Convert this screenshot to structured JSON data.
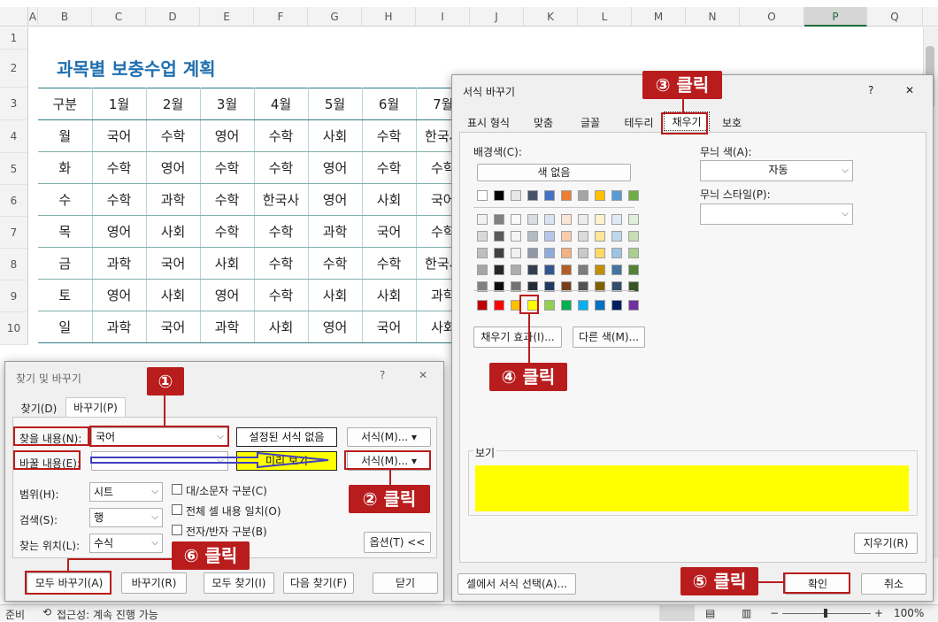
{
  "sheet": {
    "columns": [
      "A",
      "B",
      "C",
      "D",
      "E",
      "F",
      "G",
      "H",
      "I",
      "J",
      "K",
      "L",
      "M",
      "N",
      "O",
      "P",
      "Q"
    ],
    "rows": [
      "1",
      "2",
      "3",
      "4",
      "5",
      "6",
      "7",
      "8",
      "9",
      "10"
    ],
    "title": "과목별 보충수업 계획",
    "table": [
      [
        "구분",
        "1월",
        "2월",
        "3월",
        "4월",
        "5월",
        "6월",
        "7월"
      ],
      [
        "월",
        "국어",
        "수학",
        "영어",
        "수학",
        "사회",
        "수학",
        "한국사"
      ],
      [
        "화",
        "수학",
        "영어",
        "수학",
        "수학",
        "영어",
        "수학",
        "수학"
      ],
      [
        "수",
        "수학",
        "과학",
        "수학",
        "한국사",
        "영어",
        "사회",
        "국어"
      ],
      [
        "목",
        "영어",
        "사회",
        "수학",
        "수학",
        "과학",
        "국어",
        "수학"
      ],
      [
        "금",
        "과학",
        "국어",
        "사회",
        "수학",
        "수학",
        "수학",
        "한국사"
      ],
      [
        "토",
        "영어",
        "사회",
        "영어",
        "수학",
        "사회",
        "사회",
        "과학"
      ],
      [
        "일",
        "과학",
        "국어",
        "과학",
        "사회",
        "영어",
        "국어",
        "사회"
      ]
    ]
  },
  "status": {
    "ready": "준비",
    "accessibility": "접근성: 계속 진행 가능",
    "zoom": "100%"
  },
  "find_dialog": {
    "title": "찾기 및 바꾸기",
    "help": "?",
    "close": "✕",
    "tabs": [
      "찾기(D)",
      "바꾸기(P)"
    ],
    "find_label": "찾을 내용(N):",
    "find_value": "국어",
    "replace_label": "바꿀 내용(E):",
    "replace_value": "",
    "no_format": "설정된 서식 없음",
    "format_btn": "서식(M)...",
    "preview": "미리 보기",
    "scope_label": "범위(H):",
    "scope_value": "시트",
    "search_label": "검색(S):",
    "search_value": "행",
    "lookin_label": "찾는 위치(L):",
    "lookin_value": "수식",
    "opt_case": "대/소문자 구분(C)",
    "opt_whole": "전체 셀 내용 일치(O)",
    "opt_width": "전자/반자 구분(B)",
    "options_btn": "옵션(T) <<",
    "replace_all": "모두 바꾸기(A)",
    "replace": "바꾸기(R)",
    "find_all": "모두 찾기(I)",
    "find_next": "다음 찾기(F)",
    "close_btn": "닫기"
  },
  "format_dialog": {
    "title": "서식 바꾸기",
    "help": "?",
    "close": "✕",
    "tabs": [
      "표시 형식",
      "맞춤",
      "글꼴",
      "테두리",
      "채우기",
      "보호"
    ],
    "bg_label": "배경색(C):",
    "no_color": "색 없음",
    "fill_effects": "채우기 효과(I)...",
    "more_colors": "다른 색(M)...",
    "pattern_color_label": "무늬 색(A):",
    "pattern_color_value": "자동",
    "pattern_style_label": "무늬 스타일(P):",
    "sample_label": "보기",
    "sample_color": "#ffff00",
    "clear": "지우기(R)",
    "choose_from_cell": "셀에서 서식 선택(A)...",
    "ok": "확인",
    "cancel": "취소",
    "theme_colors": [
      "#ffffff",
      "#000000",
      "#e7e6e6",
      "#44546a",
      "#4472c4",
      "#ed7d31",
      "#a5a5a5",
      "#ffc000",
      "#5b9bd5",
      "#70ad47"
    ],
    "standard_colors": [
      "#c00000",
      "#ff0000",
      "#ffc000",
      "#ffff00",
      "#92d050",
      "#00b050",
      "#00b0f0",
      "#0070c0",
      "#002060",
      "#7030a0"
    ]
  },
  "callouts": {
    "c1": "①",
    "c2": "② 클릭",
    "c3": "③ 클릭",
    "c4": "④ 클릭",
    "c5": "⑤ 클릭",
    "c6": "⑥ 클릭"
  }
}
